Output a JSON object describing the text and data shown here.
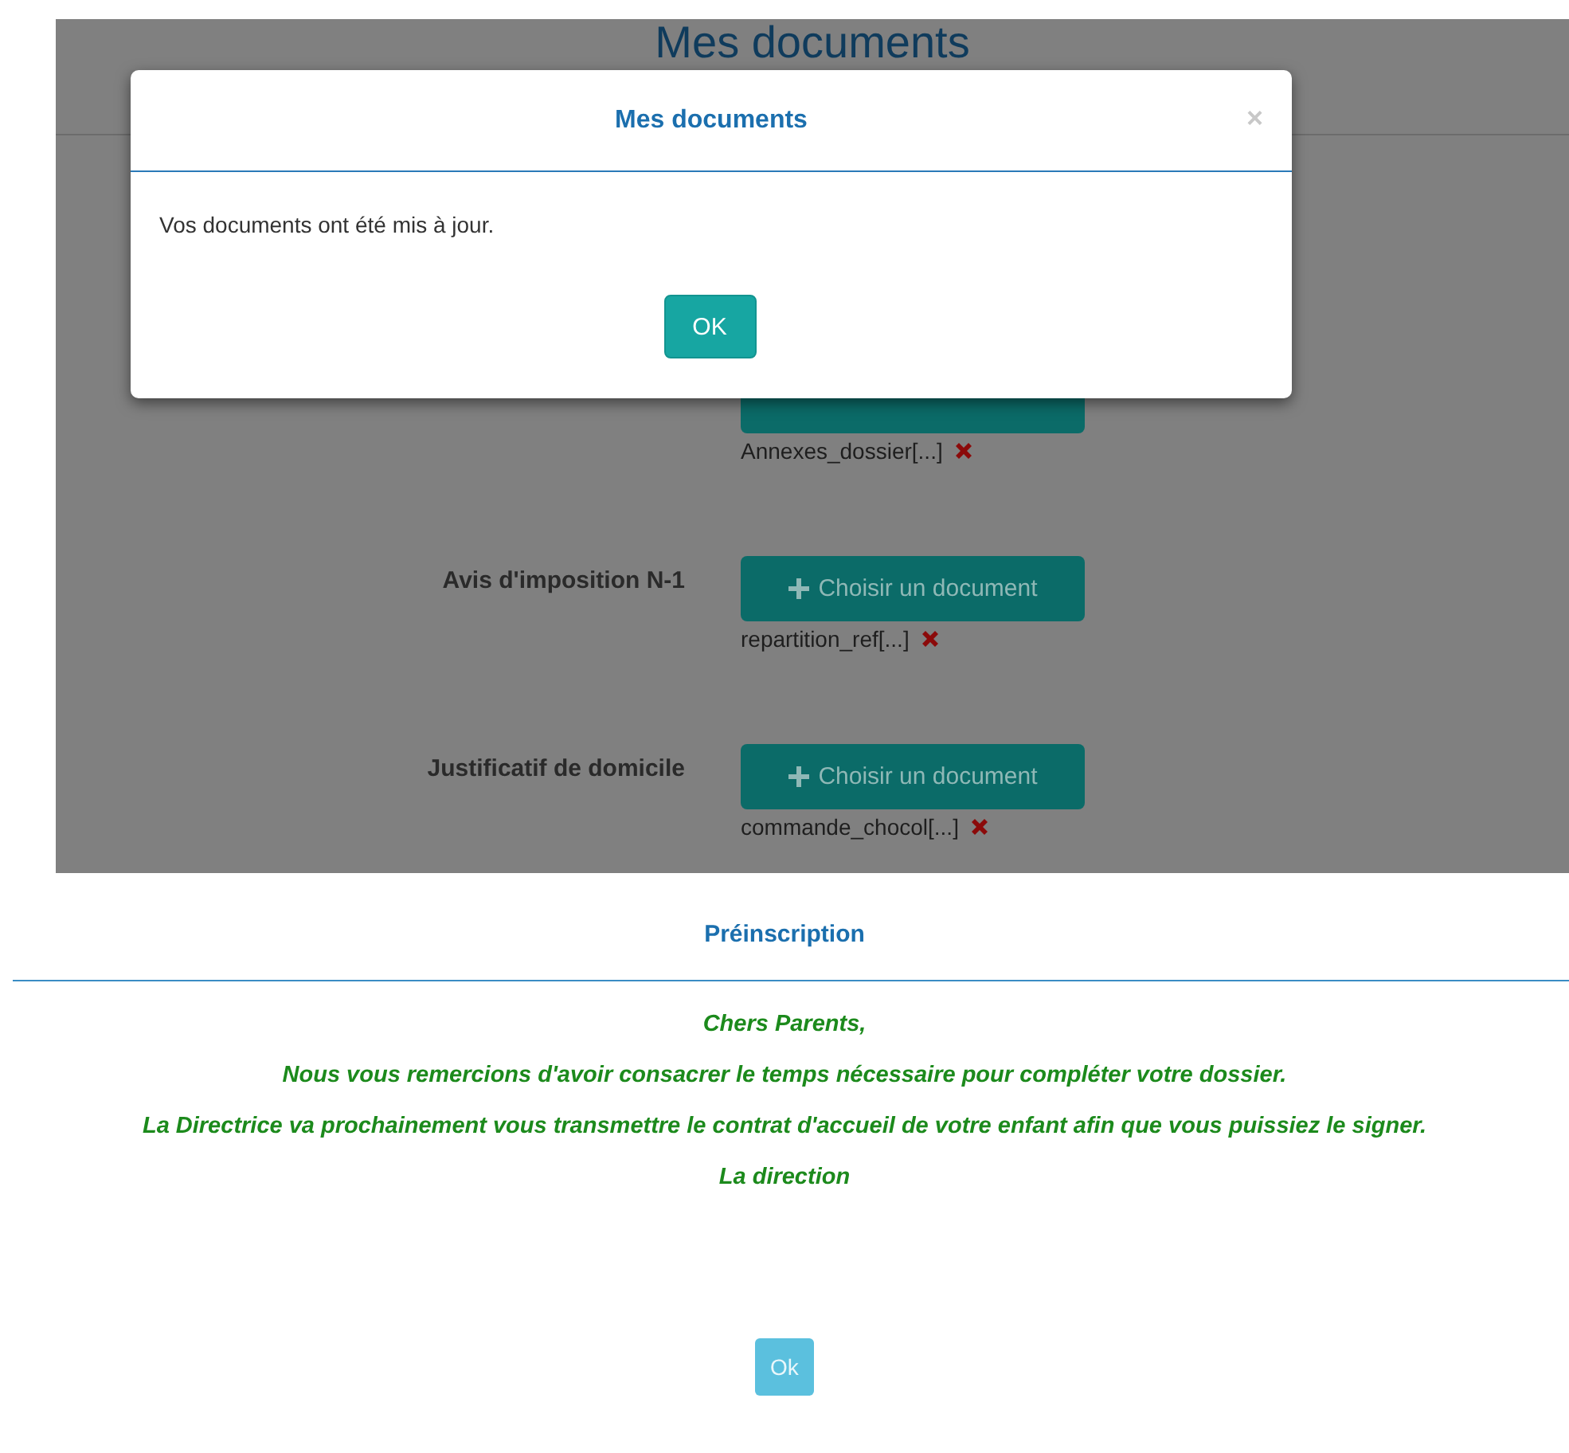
{
  "page": {
    "title": "Mes documents",
    "documents": [
      {
        "file": "Annexes_dossier[...]"
      },
      {
        "label": "Avis d'imposition N-1",
        "button_label": "Choisir un document",
        "file": "repartition_ref[...]"
      },
      {
        "label": "Justificatif de domicile",
        "button_label": "Choisir un document",
        "file": "commande_chocol[...]"
      }
    ]
  },
  "modal": {
    "title": "Mes documents",
    "close": "×",
    "message": "Vos documents ont été mis à jour.",
    "button": "OK"
  },
  "preinscription": {
    "title": "Préinscription",
    "paragraphs": [
      "Chers Parents,",
      "Nous vous remercions d'avoir consacrer le temps nécessaire pour compléter votre dossier.",
      "La Directrice va prochainement vous transmettre le contrat d'accueil de votre enfant afin que vous puissiez le signer.",
      "La direction"
    ],
    "button": "Ok"
  }
}
